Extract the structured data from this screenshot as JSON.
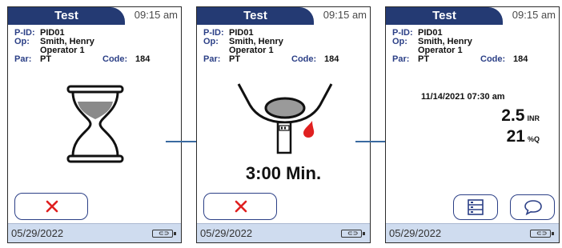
{
  "screens": [
    {
      "title": "Test",
      "time": "09:15 am",
      "info": {
        "pid_key": "P-ID:",
        "pid_val": "PID01",
        "op_key": "Op:",
        "op_name": "Smith, Henry",
        "op_role": "Operator 1",
        "par_key": "Par:",
        "par_val": "PT",
        "code_key": "Code:",
        "code_val": "184"
      },
      "date": "05/29/2022"
    },
    {
      "title": "Test",
      "time": "09:15 am",
      "info": {
        "pid_key": "P-ID:",
        "pid_val": "PID01",
        "op_key": "Op:",
        "op_name": "Smith, Henry",
        "op_role": "Operator 1",
        "par_key": "Par:",
        "par_val": "PT",
        "code_key": "Code:",
        "code_val": "184"
      },
      "countdown": "3:00  Min.",
      "date": "05/29/2022"
    },
    {
      "title": "Test",
      "time": "09:15 am",
      "info": {
        "pid_key": "P-ID:",
        "pid_val": "PID01",
        "op_key": "Op:",
        "op_name": "Smith, Henry",
        "op_role": "Operator 1",
        "par_key": "Par:",
        "par_val": "PT",
        "code_key": "Code:",
        "code_val": "184"
      },
      "result": {
        "datetime": "11/14/2021 07:30 am",
        "inr_value": "2.5",
        "inr_unit": "INR",
        "q_value": "21",
        "q_unit": "%Q"
      },
      "date": "05/29/2022"
    }
  ],
  "icons": {
    "cancel": "close-icon",
    "list": "list-icon",
    "comment": "comment-icon",
    "hourglass": "hourglass-icon",
    "strip": "test-strip-icon",
    "blood": "blood-drop-icon",
    "battery": "battery-icon",
    "arrow": "arrow-right-icon"
  },
  "colors": {
    "header": "#243a73",
    "label": "#2b3f86",
    "footer": "#cfdcef",
    "cancel_x": "#e02020",
    "blood": "#e02020",
    "arrow": "#3a6aa0"
  }
}
